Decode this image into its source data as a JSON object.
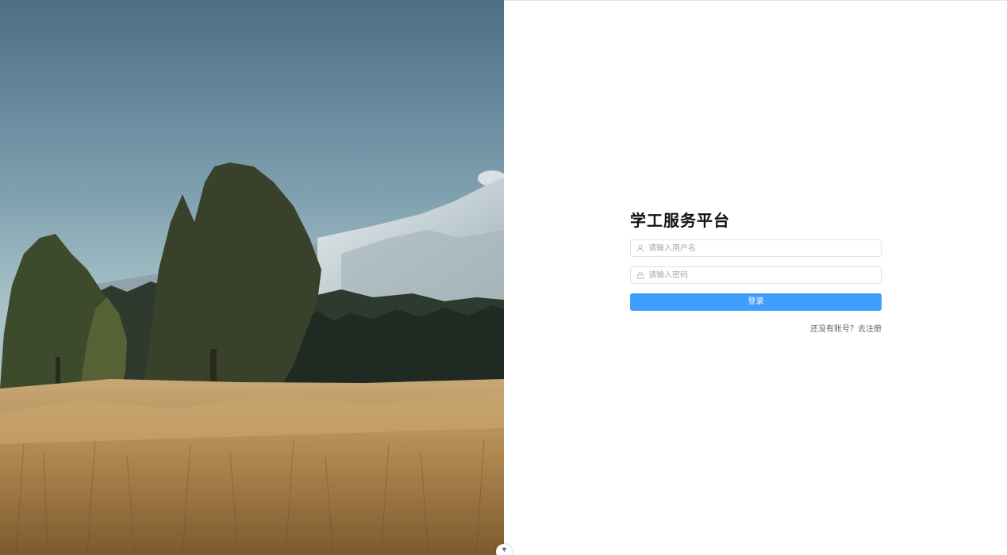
{
  "hero": {
    "image": "landscape-photo",
    "icons": {
      "scene": "mountain-wheat-field-image"
    }
  },
  "login": {
    "title": "学工服务平台",
    "username": {
      "placeholder": "请输入用户名",
      "value": "",
      "icon": "user-icon"
    },
    "password": {
      "placeholder": "请输入密码",
      "value": "",
      "icon": "lock-icon"
    },
    "submit_label": "登录",
    "register": {
      "prompt": "还没有账号？",
      "link_label": "去注册"
    }
  },
  "widget": {
    "icon": "chevron-down-icon"
  },
  "colors": {
    "primary": "#409eff",
    "title": "#111111",
    "border": "#dcdfe6",
    "placeholder": "#a8abb2",
    "muted_text": "#606266"
  }
}
